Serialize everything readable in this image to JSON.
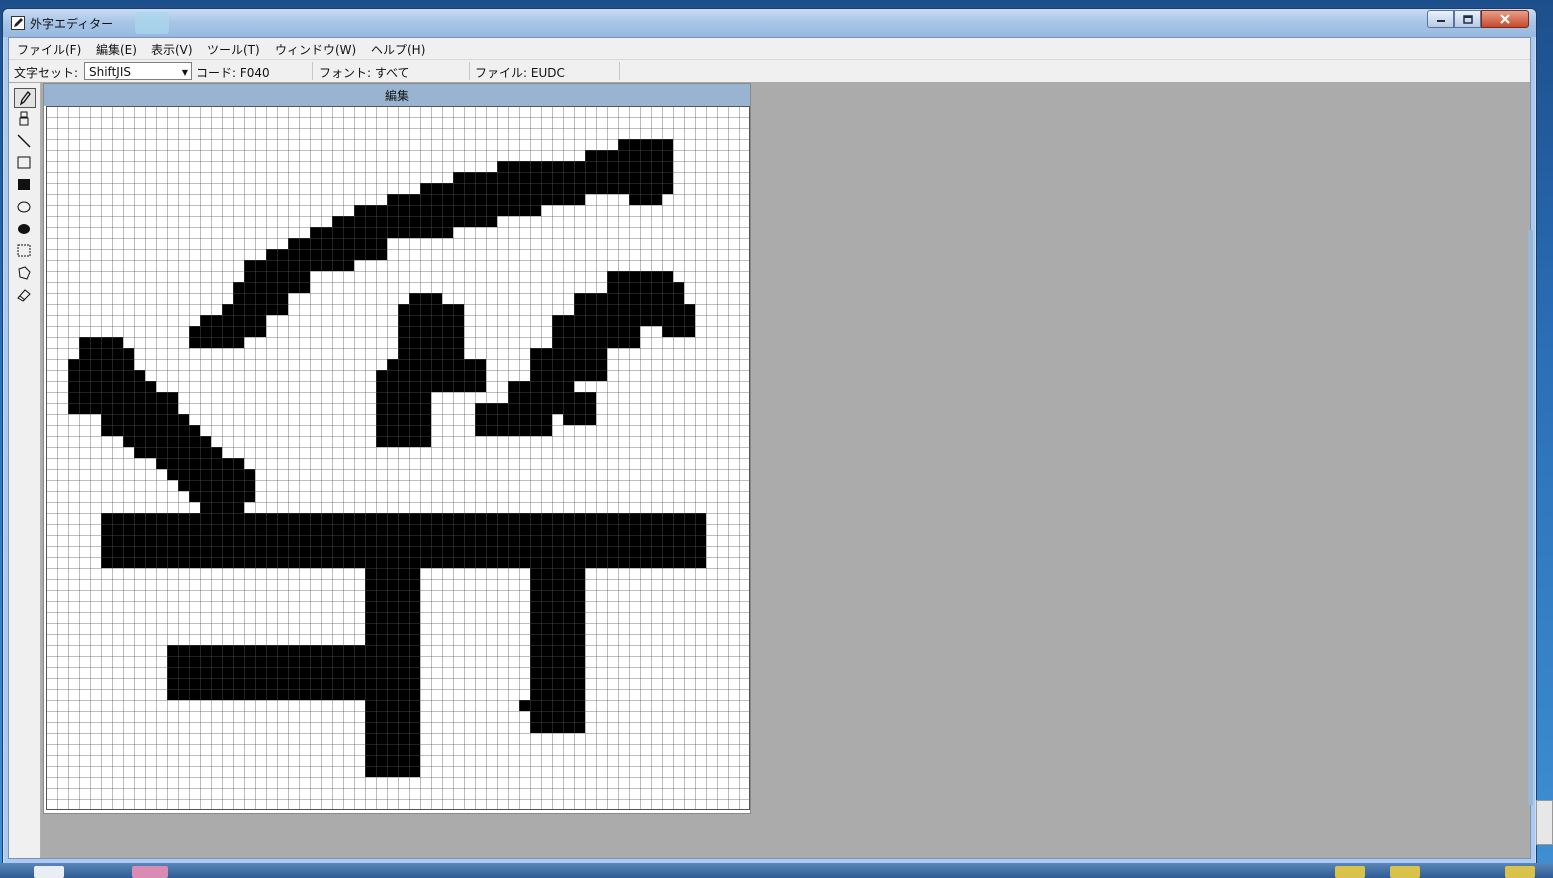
{
  "window": {
    "title": "外字エディター",
    "icon": "pencil-icon",
    "controls": {
      "minimize": "minimize-icon",
      "maximize": "maximize-icon",
      "close": "close-icon"
    }
  },
  "menu": [
    {
      "label": "ファイル(F)"
    },
    {
      "label": "編集(E)"
    },
    {
      "label": "表示(V)"
    },
    {
      "label": "ツール(T)"
    },
    {
      "label": "ウィンドウ(W)"
    },
    {
      "label": "ヘルプ(H)"
    }
  ],
  "toolbar": {
    "charset_label": "文字セット:",
    "charset_value": "ShiftJIS",
    "code": "コード: F040",
    "font": "フォント: すべて",
    "file": "ファイル: EUDC"
  },
  "tools": [
    "pencil-icon",
    "brush-icon",
    "line-icon",
    "rectangle-outline-icon",
    "rectangle-filled-icon",
    "ellipse-outline-icon",
    "ellipse-filled-icon",
    "rect-select-icon",
    "freeform-select-icon",
    "eraser-icon"
  ],
  "active_tool": "pencil-icon",
  "editor": {
    "title": "編集",
    "grid_size": 64,
    "glyph_strokes": [
      [
        2,
        23,
        4,
        5
      ],
      [
        3,
        21,
        4,
        3
      ],
      [
        4,
        22,
        4,
        6
      ],
      [
        5,
        24,
        4,
        6
      ],
      [
        6,
        25,
        4,
        5
      ],
      [
        7,
        26,
        5,
        5
      ],
      [
        8,
        27,
        4,
        5
      ],
      [
        9,
        28,
        4,
        4
      ],
      [
        10,
        29,
        4,
        4
      ],
      [
        11,
        30,
        4,
        4
      ],
      [
        12,
        31,
        4,
        4
      ],
      [
        13,
        32,
        4,
        4
      ],
      [
        14,
        32,
        4,
        5
      ],
      [
        15,
        33,
        4,
        3
      ],
      [
        16,
        34,
        3,
        2
      ],
      [
        13,
        20,
        3,
        2
      ],
      [
        14,
        19,
        4,
        3
      ],
      [
        16,
        18,
        4,
        3
      ],
      [
        17,
        16,
        5,
        3
      ],
      [
        18,
        14,
        6,
        3
      ],
      [
        20,
        13,
        6,
        2
      ],
      [
        22,
        12,
        6,
        3
      ],
      [
        24,
        11,
        7,
        3
      ],
      [
        26,
        10,
        8,
        2
      ],
      [
        28,
        9,
        9,
        3
      ],
      [
        31,
        8,
        10,
        3
      ],
      [
        34,
        7,
        11,
        3
      ],
      [
        37,
        6,
        12,
        3
      ],
      [
        41,
        5,
        12,
        3
      ],
      [
        45,
        5,
        10,
        2
      ],
      [
        49,
        4,
        8,
        4
      ],
      [
        52,
        3,
        5,
        2
      ],
      [
        53,
        5,
        3,
        4
      ],
      [
        30,
        24,
        5,
        7
      ],
      [
        31,
        23,
        9,
        3
      ],
      [
        32,
        18,
        6,
        5
      ],
      [
        33,
        17,
        3,
        2
      ],
      [
        39,
        27,
        5,
        3
      ],
      [
        42,
        25,
        4,
        5
      ],
      [
        44,
        22,
        4,
        6
      ],
      [
        46,
        19,
        5,
        6
      ],
      [
        48,
        17,
        6,
        5
      ],
      [
        51,
        15,
        4,
        5
      ],
      [
        54,
        15,
        3,
        3
      ],
      [
        55,
        16,
        3,
        4
      ],
      [
        56,
        18,
        3,
        3
      ],
      [
        47,
        26,
        3,
        3
      ],
      [
        5,
        37,
        55,
        5
      ],
      [
        29,
        42,
        5,
        19
      ],
      [
        11,
        49,
        19,
        5
      ],
      [
        44,
        42,
        5,
        15
      ],
      [
        43,
        54,
        1,
        1
      ]
    ]
  }
}
